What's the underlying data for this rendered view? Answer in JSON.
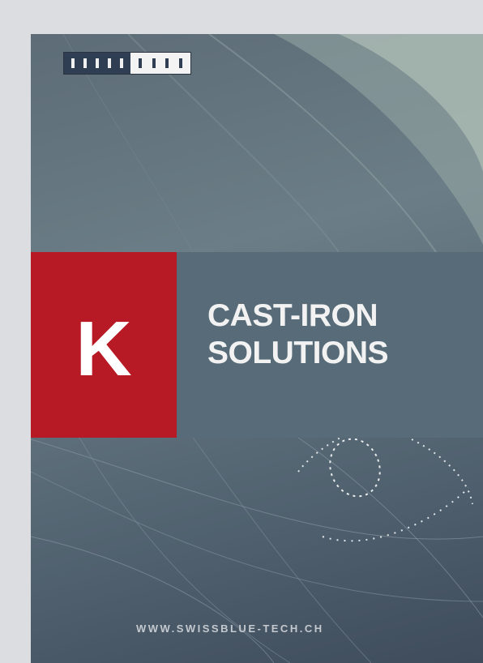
{
  "cover": {
    "logo_letter": "K",
    "title_line1": "CAST-IRON",
    "title_line2": "SOLUTIONS",
    "website": "WWW.SWISSBLUE-TECH.CH",
    "brand_logo_icon": "brand-logo-icon"
  },
  "colors": {
    "accent_red": "#b71a24",
    "band": "#576c78",
    "background_dark": "#3e4c5c"
  }
}
